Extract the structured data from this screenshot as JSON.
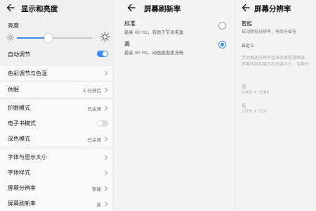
{
  "display": {
    "title": "显示和亮度",
    "brightness_label": "亮度",
    "brightness_level": 0.42,
    "auto_adjust": {
      "label": "自动调节",
      "on": true
    },
    "items": [
      {
        "label": "色彩调节与色温",
        "value": ""
      },
      {
        "label": "休眠",
        "value": "5 分钟后"
      },
      {
        "label": "护眼模式",
        "value": "已关闭"
      },
      {
        "label": "电子书模式",
        "value": ""
      },
      {
        "label": "深色模式",
        "value": "已关闭"
      },
      {
        "label": "字体与显示大小",
        "value": ""
      },
      {
        "label": "字体样式",
        "value": ""
      },
      {
        "label": "屏幕分辨率",
        "value": "智能"
      },
      {
        "label": "屏幕刷新率",
        "value": "高"
      }
    ],
    "ebook_mode_on": false,
    "accent_color": "#3d8cf5"
  },
  "refresh": {
    "title": "屏幕刷新率",
    "options": [
      {
        "title": "标准",
        "subtitle": "最高 60 Hz，有助于节省电量",
        "selected": false
      },
      {
        "title": "高",
        "subtitle": "最高 90 Hz，动画画面更流畅",
        "selected": true
      }
    ]
  },
  "resolution": {
    "title": "屏幕分辨率",
    "smart": {
      "title": "智能",
      "subtitle": "自动降低分辨率，有助于省电"
    },
    "custom_label": "自定义",
    "custom_desc": [
      "手动更改分辨率会改变屏幕清晰度，",
      "屏幕布局和显示的内容大小，但部分"
    ],
    "high": {
      "title": "高",
      "res": "2400 × 1080"
    },
    "low": {
      "title": "低",
      "res": "1600 × 720"
    }
  }
}
